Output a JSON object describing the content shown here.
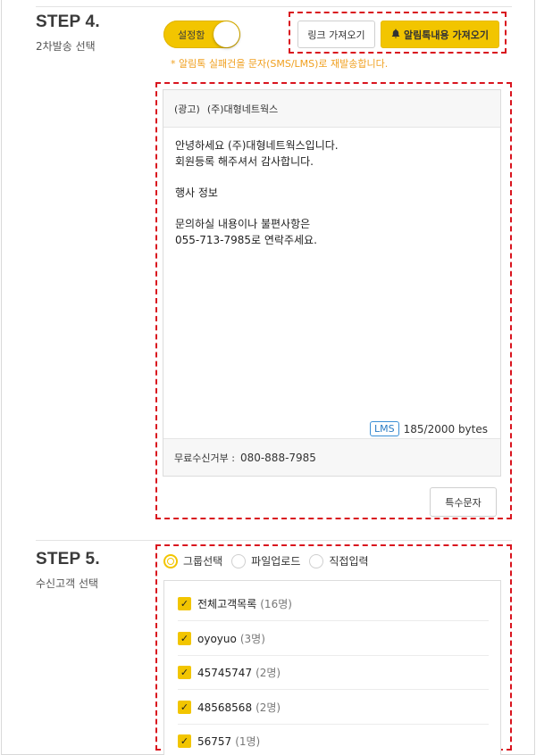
{
  "step4": {
    "title": "STEP 4.",
    "subtitle": "2차발송 선택",
    "toggle_label": "설정함",
    "link_button": "링크 가져오기",
    "alimtalk_button": "알림톡내용 가져오기",
    "notice": "* 알림톡 실패건을 문자(SMS/LMS)로 재발송합니다.",
    "message": {
      "ad_tag": "(광고)",
      "company": "(주)대형네트웍스",
      "body": "안녕하세요 (주)대형네트웍스입니다.\n회원등록 해주셔서 감사합니다.\n\n행사 정보\n\n문의하실 내용이나 불편사항은\n055-713-7985로 연락주세요.",
      "type_badge": "LMS",
      "bytes": "185/2000 bytes",
      "optout_label": "무료수신거부 :",
      "optout_number": "080-888-7985"
    },
    "special_char_button": "특수문자"
  },
  "step5": {
    "title": "STEP 5.",
    "subtitle": "수신고객 선택",
    "radios": [
      {
        "label": "그룹선택",
        "selected": true
      },
      {
        "label": "파일업로드",
        "selected": false
      },
      {
        "label": "직접입력",
        "selected": false
      }
    ],
    "groups": [
      {
        "name": "전체고객목록",
        "count": "(16명)"
      },
      {
        "name": "oyoyuo",
        "count": "(3명)"
      },
      {
        "name": "45745747",
        "count": "(2명)"
      },
      {
        "name": "48568568",
        "count": "(2명)"
      },
      {
        "name": "56757",
        "count": "(1명)"
      }
    ]
  },
  "colors": {
    "accent": "#f2c500",
    "highlight_dash": "#d9141e",
    "notice": "#f0a020",
    "lms_badge": "#2b7cc4"
  }
}
